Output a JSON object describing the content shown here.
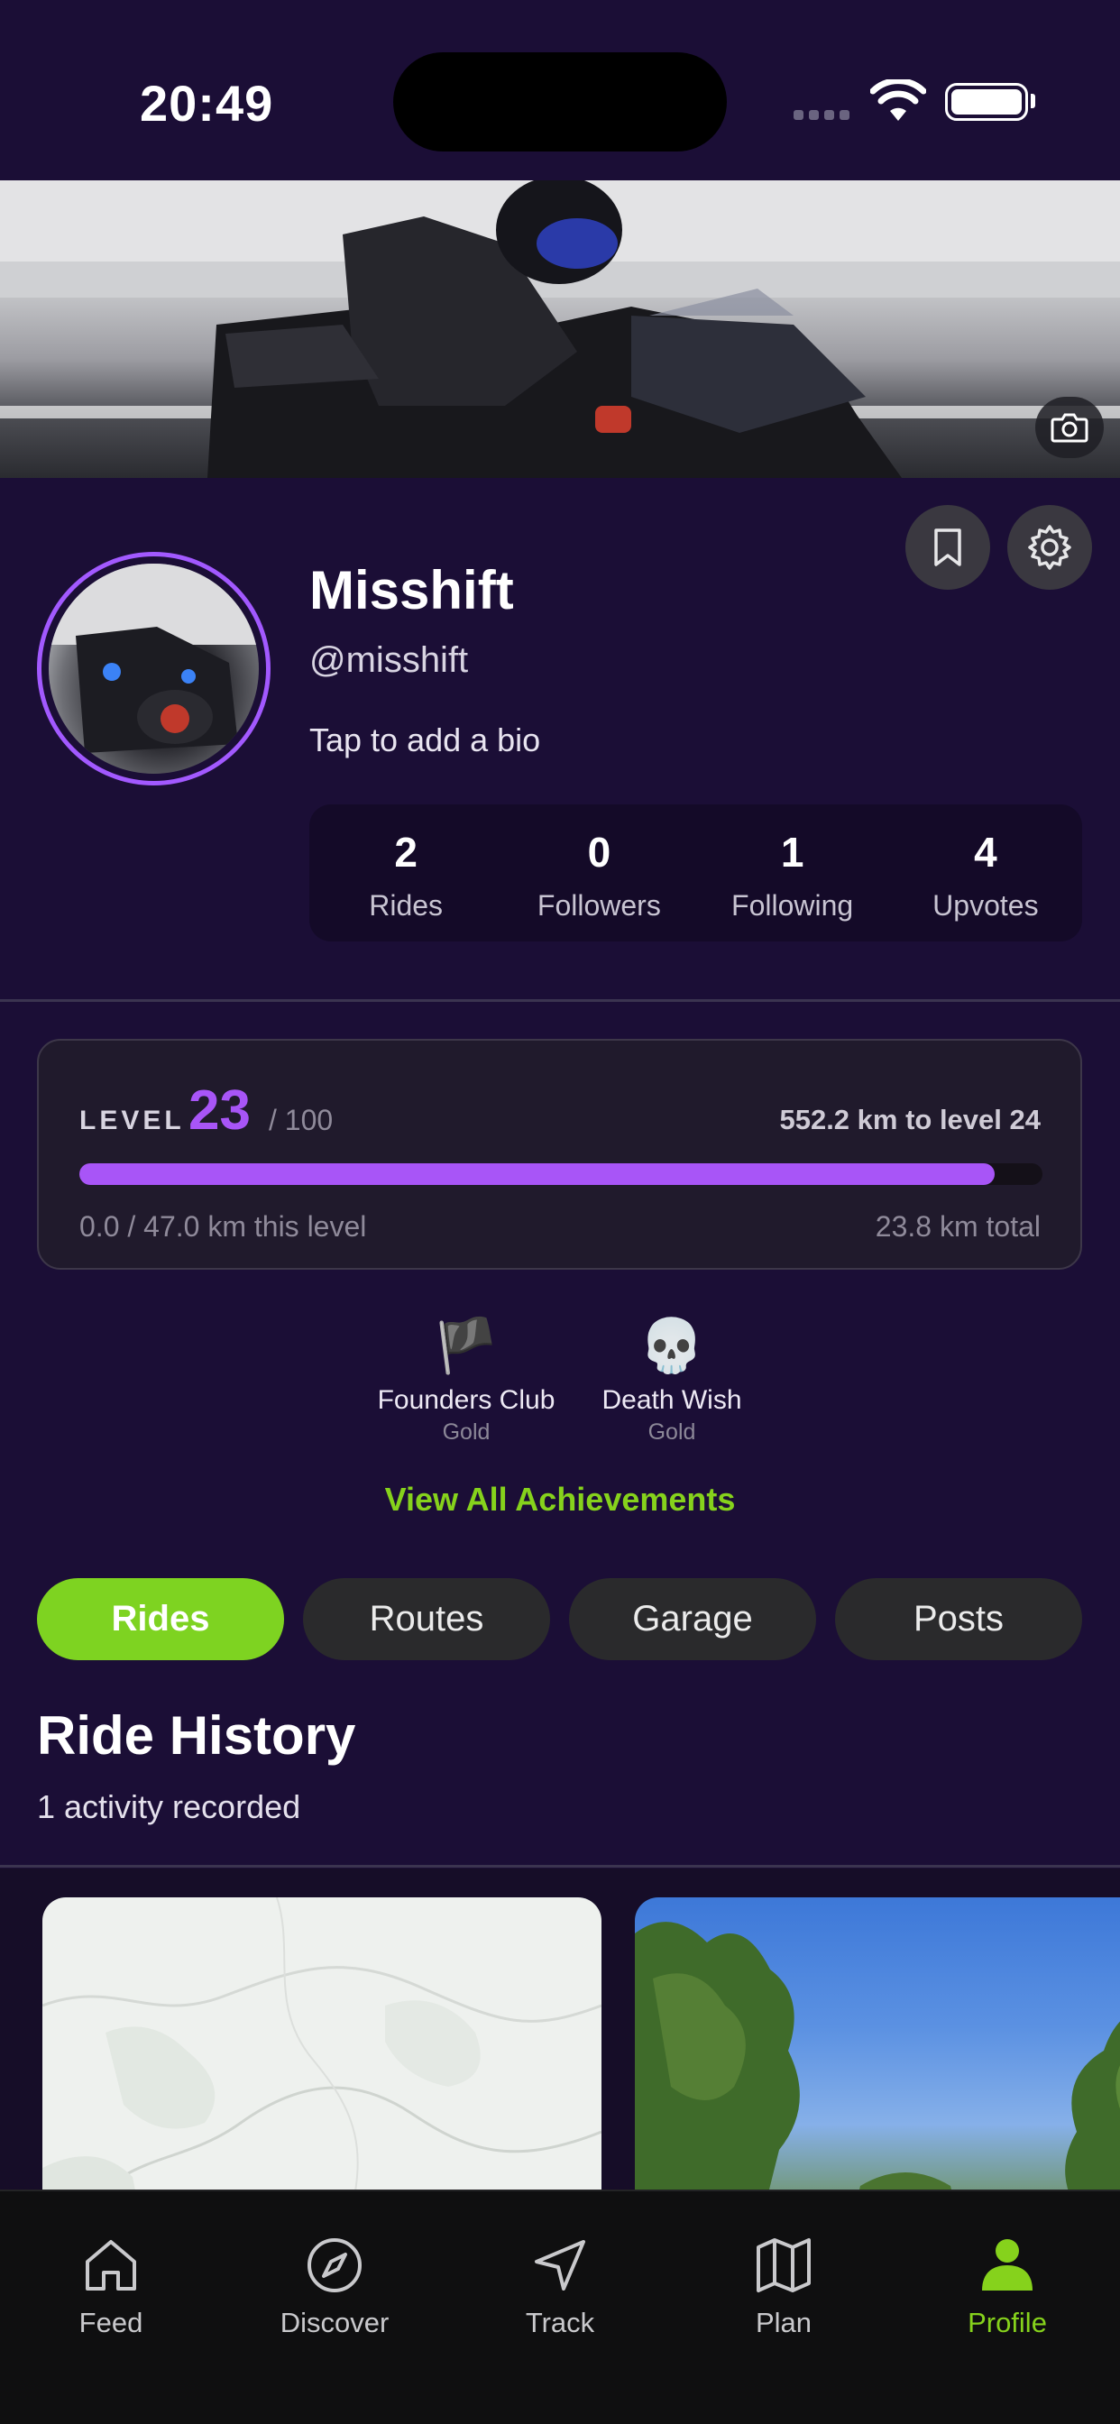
{
  "status_bar": {
    "time": "20:49"
  },
  "profile": {
    "name": "Misshift",
    "handle": "@misshift",
    "bio_placeholder": "Tap to add a bio",
    "stats": [
      {
        "value": "2",
        "label": "Rides"
      },
      {
        "value": "0",
        "label": "Followers"
      },
      {
        "value": "1",
        "label": "Following"
      },
      {
        "value": "4",
        "label": "Upvotes"
      }
    ]
  },
  "level": {
    "label": "LEVEL",
    "current": "23",
    "max": "/ 100",
    "next": "552.2 km to level 24",
    "progress_fraction": 0.95,
    "progress_text": "0.0 / 47.0 km this level",
    "total_text": "23.8 km total",
    "accent_color": "#a855f7"
  },
  "achievements": {
    "items": [
      {
        "icon": "🏴",
        "icon_name": "black-flag-icon",
        "name": "Founders Club",
        "tier": "Gold"
      },
      {
        "icon": "💀",
        "icon_name": "skull-icon",
        "name": "Death Wish",
        "tier": "Gold"
      }
    ],
    "view_all": "View All Achievements"
  },
  "tabs": [
    {
      "label": "Rides",
      "active": true
    },
    {
      "label": "Routes",
      "active": false
    },
    {
      "label": "Garage",
      "active": false
    },
    {
      "label": "Posts",
      "active": false
    }
  ],
  "ride_history": {
    "title": "Ride History",
    "subtitle": "1 activity recorded"
  },
  "nav": [
    {
      "label": "Feed",
      "icon": "home-icon",
      "active": false
    },
    {
      "label": "Discover",
      "icon": "compass-icon",
      "active": false
    },
    {
      "label": "Track",
      "icon": "navigation-arrow-icon",
      "active": false
    },
    {
      "label": "Plan",
      "icon": "map-icon",
      "active": false
    },
    {
      "label": "Profile",
      "icon": "person-icon",
      "active": true
    }
  ],
  "colors": {
    "background": "#1b0e36",
    "brand_green": "#7ed321",
    "accent_purple": "#a855f7"
  }
}
